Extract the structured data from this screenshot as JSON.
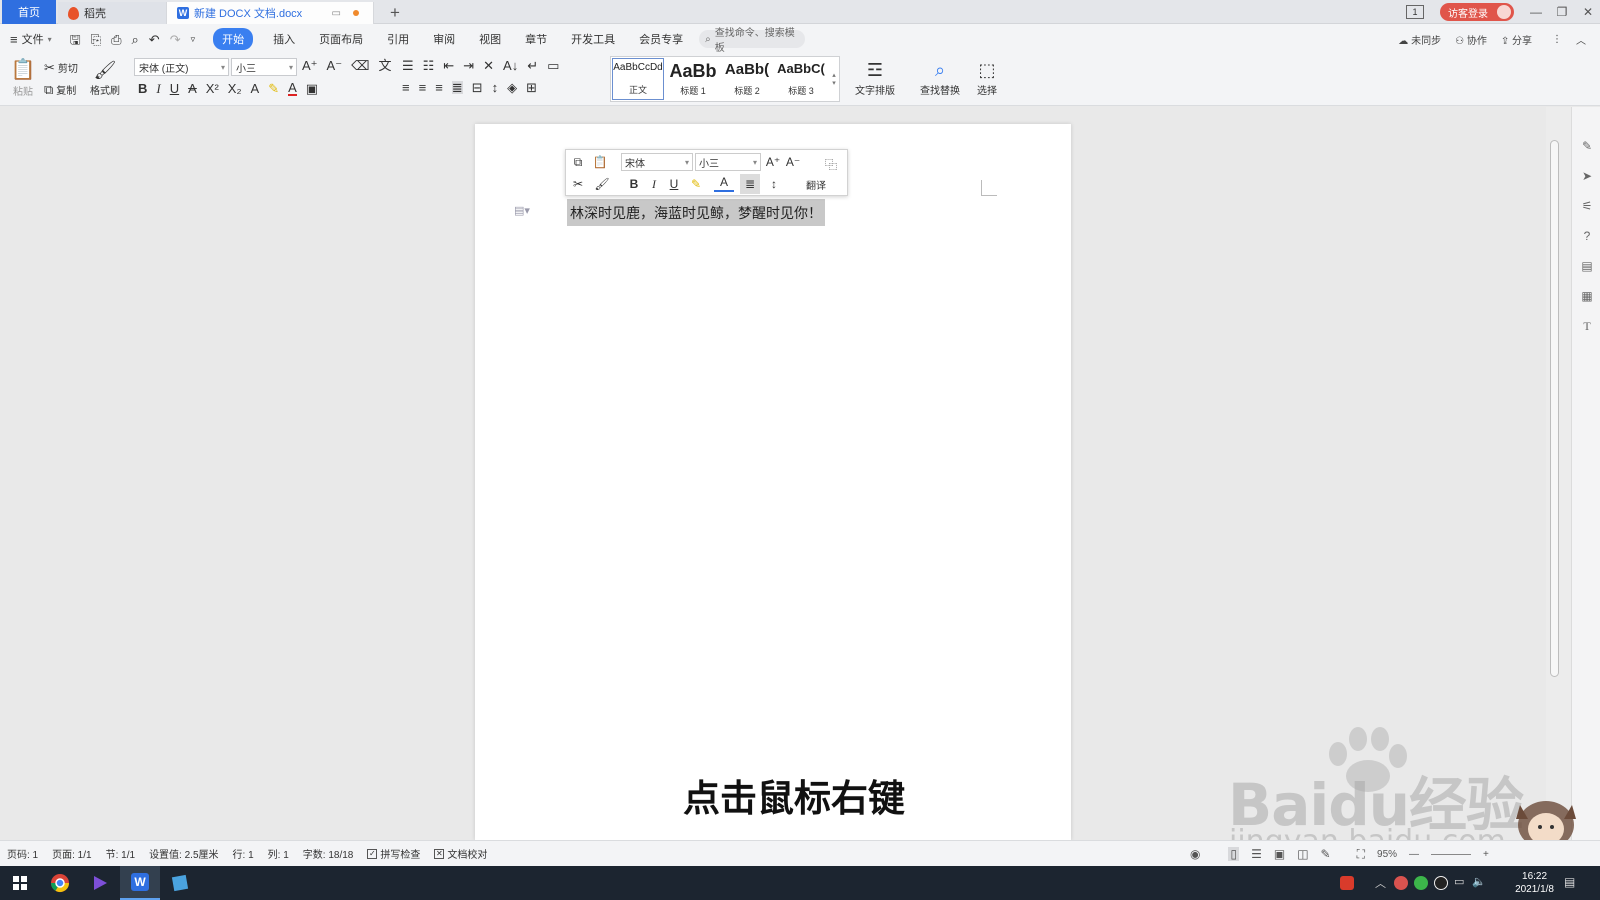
{
  "tabs": {
    "home": "首页",
    "daoke": "稻壳",
    "document": "新建 DOCX 文档.docx"
  },
  "window": {
    "page_badge": "1",
    "login": "访客登录"
  },
  "menu": {
    "file": "文件",
    "items": [
      "开始",
      "插入",
      "页面布局",
      "引用",
      "审阅",
      "视图",
      "章节",
      "开发工具",
      "会员专享"
    ],
    "search_placeholder": "查找命令、搜索模板",
    "sync": "未同步",
    "collab": "协作",
    "share": "分享"
  },
  "ribbon": {
    "paste": "粘贴",
    "cut": "剪切",
    "copy": "复制",
    "format_painter": "格式刷",
    "font": "宋体 (正文)",
    "size": "小三",
    "styles": [
      {
        "sample": "AaBbCcDd",
        "label": "正文"
      },
      {
        "sample": "AaBb",
        "label": "标题 1"
      },
      {
        "sample": "AaBb(",
        "label": "标题 2"
      },
      {
        "sample": "AaBbC(",
        "label": "标题 3"
      }
    ],
    "text_layout": "文字排版",
    "find_replace": "查找替换",
    "select": "选择"
  },
  "mini_toolbar": {
    "font": "宋体",
    "size": "小三",
    "translate": "翻译"
  },
  "document": {
    "text": "林深时见鹿，海蓝时见鲸，梦醒时见你！"
  },
  "status": {
    "page_code": "页码: 1",
    "pages": "页面: 1/1",
    "section": "节: 1/1",
    "setting": "设置值: 2.5厘米",
    "row": "行: 1",
    "col": "列: 1",
    "word_count": "字数: 18/18",
    "spell_check": "拼写检查",
    "doc_proof": "文档校对",
    "zoom": "95%"
  },
  "overlay": {
    "subtitle": "点击鼠标右键",
    "watermark": "Baidu经验",
    "watermark_url": "jingyan.baidu.com"
  },
  "taskbar": {
    "time": "16:22",
    "date": "2021/1/8"
  },
  "colors": {
    "accent": "#2f6fe0",
    "login": "#e0554a",
    "selection": "#c8c8c8"
  }
}
